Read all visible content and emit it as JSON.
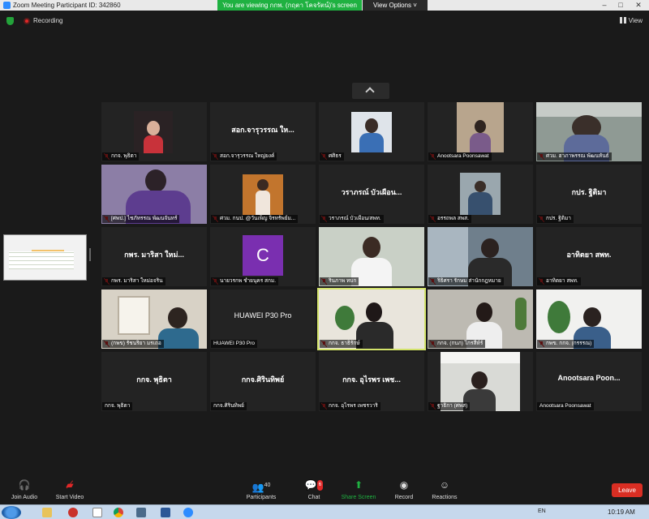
{
  "window": {
    "title": "Zoom Meeting Participant ID: 342860"
  },
  "banner": {
    "text": "You are viewing กกพ. (กฤตา โคจรัตน์)'s screen",
    "view_options": "View Options ˅"
  },
  "topbar": {
    "recording": "Recording",
    "view": "View"
  },
  "tiles": [
    {
      "name": "กกจ. พุธิตา",
      "big": ""
    },
    {
      "name": "สอก.จารุวรรณ ใหญ่ยงค์",
      "big": "สอก.จารุวรรณ ให..."
    },
    {
      "name": "ศศิธร",
      "big": ""
    },
    {
      "name": "Anootsara Poonsawat",
      "big": ""
    },
    {
      "name": "ศวม. ฮาภาพรรณ พัฒนหันธ์",
      "big": ""
    },
    {
      "name": "[ศพป.] ไชภัทรรณ พัฒนจันทร์",
      "big": ""
    },
    {
      "name": "ศวม. กนป. @วันเพ็ญ จิรทรัพย์ม...",
      "big": ""
    },
    {
      "name": "วราภรณ์ บัวเผือน/สพท.",
      "big": "วราภรณ์ บัวเผือน..."
    },
    {
      "name": "อรรถพล สพส.",
      "big": ""
    },
    {
      "name": "กปร. ฐิติมา",
      "big": "กปร. ฐิติมา"
    },
    {
      "name": "กพร. มาริสา ใหม่อจริน",
      "big": "กพร. มาริสา ใหม่..."
    },
    {
      "name": "นายวรกพ ชำยนุคร สกม.",
      "big": "C"
    },
    {
      "name": "รินภาพ ทบก",
      "big": ""
    },
    {
      "name": "ริธิศรา รักษม ส่านักกฎหมาย",
      "big": ""
    },
    {
      "name": "อาทิตยา สพท.",
      "big": "อาทิตยา สพท."
    },
    {
      "name": "(กพข) รัชนริยา มรเถอ",
      "big": ""
    },
    {
      "name": "HUAWEI P30 Pro",
      "big": "HUAWEI P30 Pro"
    },
    {
      "name": "กกจ. ธาธิรักษ์",
      "big": ""
    },
    {
      "name": "กกจ. (กบภ) ไกรสีห์ร์",
      "big": ""
    },
    {
      "name": "กพข. กกจ. (กรรรณ)",
      "big": ""
    },
    {
      "name": "กกจ. พุธิตา",
      "big": "กกจ. พุธิตา"
    },
    {
      "name": "กกจ.ศิรินทิพย์",
      "big": "กกจ.ศิรินทิพย์"
    },
    {
      "name": "กกจ. อุไรพร เพชรวาริ",
      "big": "กกจ. อุไรพร เพช..."
    },
    {
      "name": "ฐาธิกา (ศพส)",
      "big": ""
    },
    {
      "name": "Anootsara Poonsawat",
      "big": "Anootsara Poon..."
    }
  ],
  "toolbar": {
    "join_audio": "Join Audio",
    "start_video": "Start Video",
    "participants": "Participants",
    "participants_count": "40",
    "chat": "Chat",
    "chat_badge": "6",
    "share": "Share Screen",
    "record": "Record",
    "reactions": "Reactions",
    "leave": "Leave"
  },
  "taskbar": {
    "lang": "EN",
    "time": "10:19 AM"
  }
}
